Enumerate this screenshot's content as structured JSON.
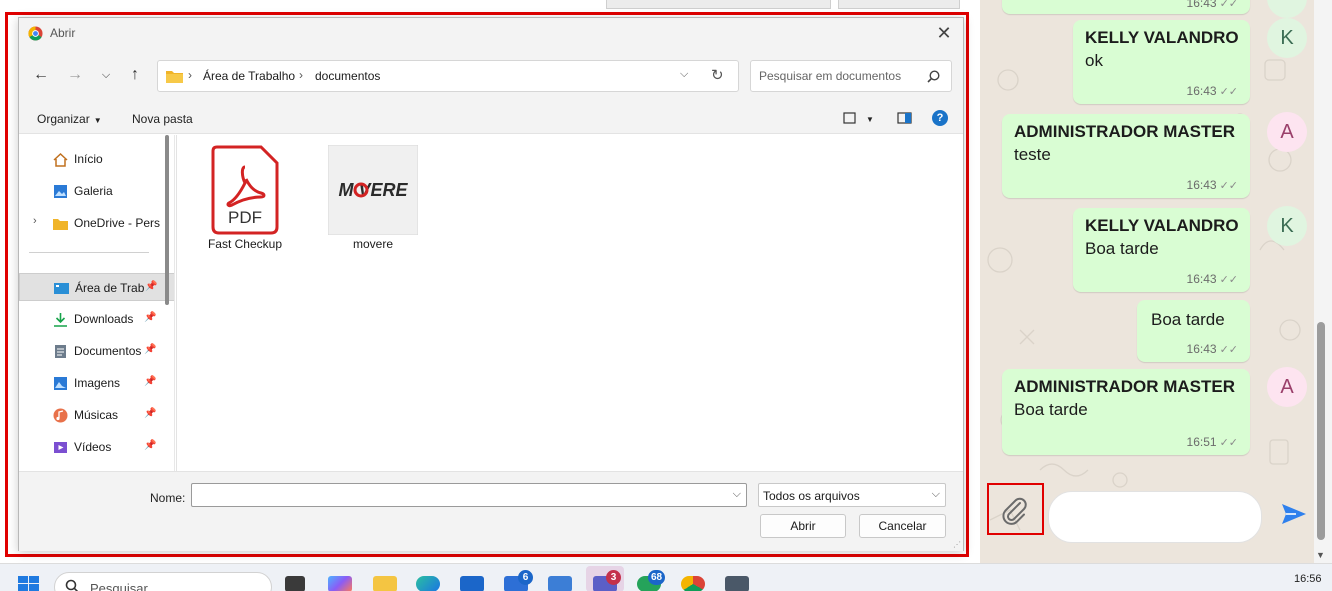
{
  "dialog": {
    "title": "Abrir",
    "breadcrumb": [
      "Área de Trabalho",
      "documentos"
    ],
    "search_placeholder": "Pesquisar em documentos",
    "organize_label": "Organizar",
    "new_folder_label": "Nova pasta",
    "help_label": "?",
    "nav_items": [
      {
        "label": "Início",
        "icon": "home-icon"
      },
      {
        "label": "Galeria",
        "icon": "gallery-icon"
      },
      {
        "label": "OneDrive - Pers",
        "icon": "folder-icon"
      },
      {
        "label": "Área de Trab",
        "icon": "desktop-icon"
      },
      {
        "label": "Downloads",
        "icon": "download-icon"
      },
      {
        "label": "Documentos",
        "icon": "document-icon"
      },
      {
        "label": "Imagens",
        "icon": "image-icon"
      },
      {
        "label": "Músicas",
        "icon": "music-icon"
      },
      {
        "label": "Vídeos",
        "icon": "video-icon"
      }
    ],
    "files": [
      {
        "name": "Fast Checkup",
        "thumb_text": "PDF"
      },
      {
        "name": "movere",
        "thumb_text": "M VERE"
      }
    ],
    "name_label": "Nome:",
    "name_value": "",
    "filter_value": "Todos os arquivos",
    "open_label": "Abrir",
    "cancel_label": "Cancelar",
    "colors": {
      "selection": "#e1e1e1",
      "accent": "#1a73c8",
      "highlight_frame": "#e00000"
    }
  },
  "chat": {
    "messages": [
      {
        "author": "",
        "text": "",
        "time": "16:43",
        "avatar": ""
      },
      {
        "author": "KELLY VALANDRO",
        "text": "ok",
        "time": "16:43",
        "avatar": "K"
      },
      {
        "author": "ADMINISTRADOR MASTER",
        "text": "teste",
        "time": "16:43",
        "avatar": "A"
      },
      {
        "author": "KELLY VALANDRO",
        "text": "Boa tarde",
        "time": "16:43",
        "avatar": "K"
      },
      {
        "author": "",
        "text": "Boa tarde",
        "time": "16:43",
        "avatar": ""
      },
      {
        "author": "ADMINISTRADOR MASTER",
        "text": "Boa tarde",
        "time": "16:51",
        "avatar": "A"
      }
    ],
    "input_value": "",
    "colors": {
      "bubble": "#d9fdd3",
      "send": "#2f80ed"
    }
  },
  "taskbar": {
    "search_placeholder": "Pesquisar",
    "badges": {
      "teams": "3",
      "todo": "6",
      "whatsapp": "68"
    },
    "clock": "16:56"
  }
}
